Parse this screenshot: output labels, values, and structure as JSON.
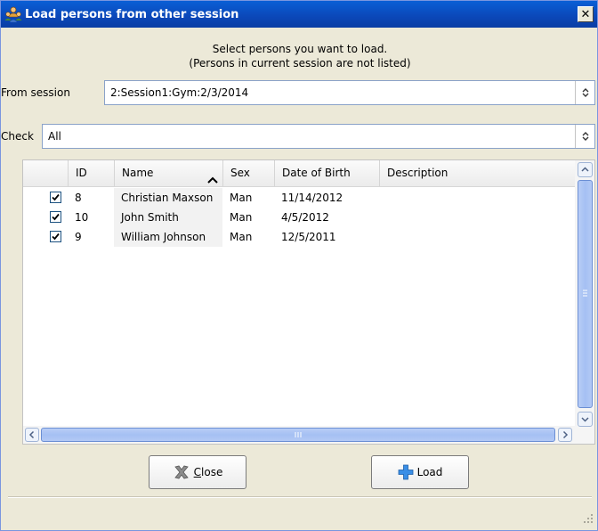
{
  "window": {
    "title": "Load persons from other session",
    "close_symbol": "✕",
    "icon": "persons-group-icon",
    "titlebar_color": "#0b47b8"
  },
  "instructions": {
    "line1": "Select persons you want to load.",
    "line2": "(Persons in current session are not listed)"
  },
  "from_session": {
    "label": "From session",
    "value": "2:Session1:Gym:2/3/2014"
  },
  "check": {
    "label": "Check",
    "value": "All"
  },
  "table": {
    "columns": [
      {
        "key": "check",
        "label": ""
      },
      {
        "key": "id",
        "label": "ID"
      },
      {
        "key": "name",
        "label": "Name",
        "sorted": "ascending"
      },
      {
        "key": "sex",
        "label": "Sex"
      },
      {
        "key": "dob",
        "label": "Date of Birth"
      },
      {
        "key": "description",
        "label": "Description"
      }
    ],
    "rows": [
      {
        "checked": true,
        "id": "8",
        "name": "Christian Maxson",
        "sex": "Man",
        "dob": "11/14/2012",
        "description": ""
      },
      {
        "checked": true,
        "id": "10",
        "name": "John Smith",
        "sex": "Man",
        "dob": "4/5/2012",
        "description": ""
      },
      {
        "checked": true,
        "id": "9",
        "name": "William Johnson",
        "sex": "Man",
        "dob": "12/5/2011",
        "description": ""
      }
    ]
  },
  "buttons": {
    "close_mnemonic": "C",
    "close_rest": "lose",
    "close_icon": "x-icon",
    "load_label": "Load",
    "load_icon": "plus-icon"
  },
  "colors": {
    "accent_blue": "#3a8ee6",
    "scroll_thumb": "#a5c0f3"
  }
}
